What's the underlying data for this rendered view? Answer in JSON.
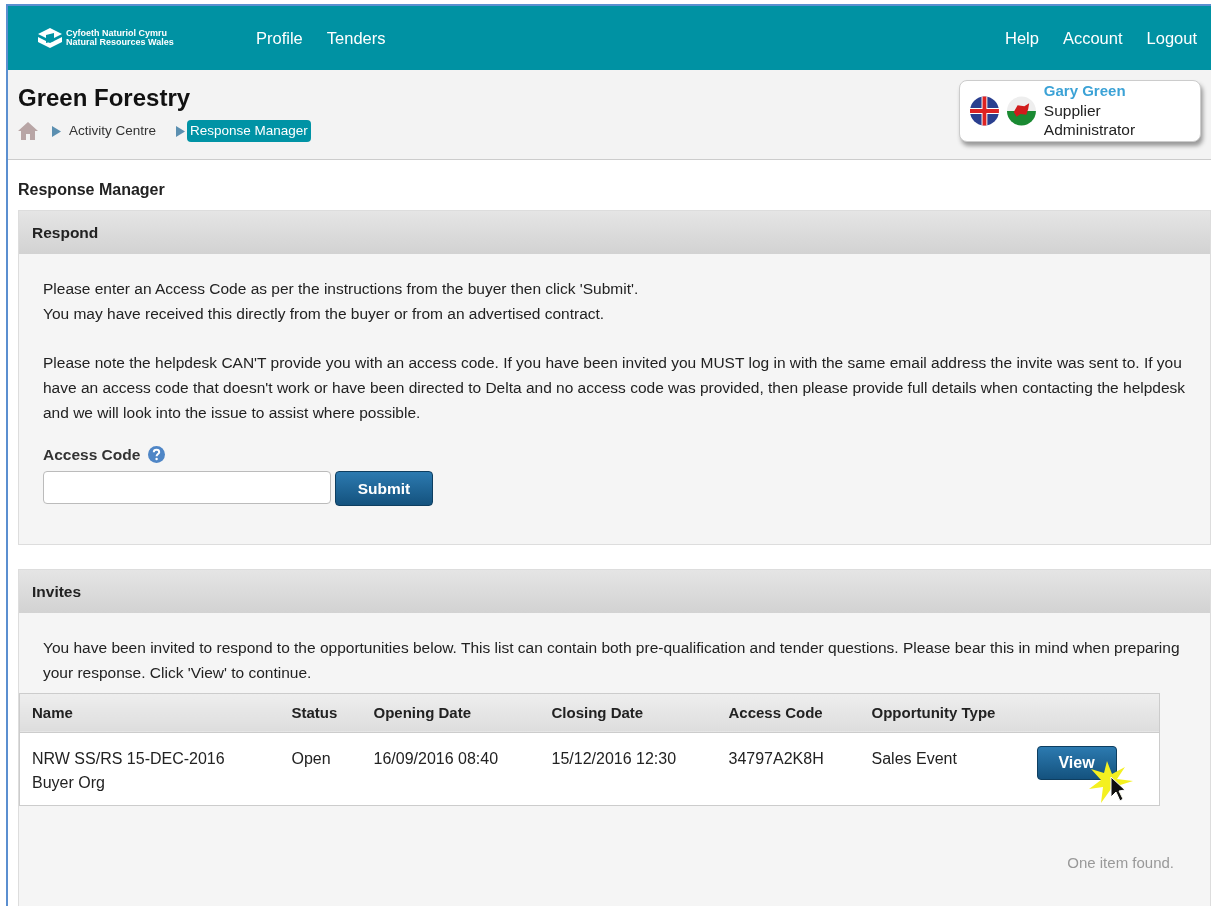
{
  "brand": {
    "line_1": "Cyfoeth Naturiol Cymru",
    "line_2": "Natural Resources Wales"
  },
  "nav_left": [
    {
      "label": "Profile"
    },
    {
      "label": "Tenders"
    }
  ],
  "nav_right": [
    {
      "label": "Help"
    },
    {
      "label": "Account"
    },
    {
      "label": "Logout"
    }
  ],
  "org_title": "Green Forestry",
  "breadcrumb": [
    {
      "label": "Activity Centre",
      "selected": false
    },
    {
      "label": "Response Manager",
      "selected": true
    }
  ],
  "user": {
    "name": "Gary Green",
    "role": "Supplier Administrator"
  },
  "page_title": "Response Manager",
  "respond": {
    "title": "Respond",
    "lines": [
      "Please enter an Access Code as per the instructions from the buyer then click 'Submit'.",
      "You may have received this directly from the buyer or from an advertised contract."
    ],
    "note": "Please note the helpdesk CAN'T provide you with an access code. If you have been invited you MUST log in with the same email address the invite was sent to. If you have an access code that doesn't work or have been directed to Delta and no access code was provided, then please provide full details when contacting the helpdesk and we will look into the issue to assist where possible.",
    "field_label": "Access Code",
    "button": "Submit"
  },
  "invites": {
    "title": "Invites",
    "intro": "You have been invited to respond to the opportunities below. This list can contain both pre-qualification and tender questions. Please bear this in mind when preparing your response. Click 'View' to continue.",
    "columns": [
      "Name",
      "Status",
      "Opening Date",
      "Closing Date",
      "Access Code",
      "Opportunity Type"
    ],
    "rows": [
      {
        "cells": [
          "NRW SS/RS 15-DEC-2016 Buyer Org",
          "Open",
          "16/09/2016 08:40",
          "15/12/2016 12:30",
          "34797A2K8H",
          "Sales Event"
        ],
        "button": "View"
      }
    ],
    "footer": "One item found."
  }
}
